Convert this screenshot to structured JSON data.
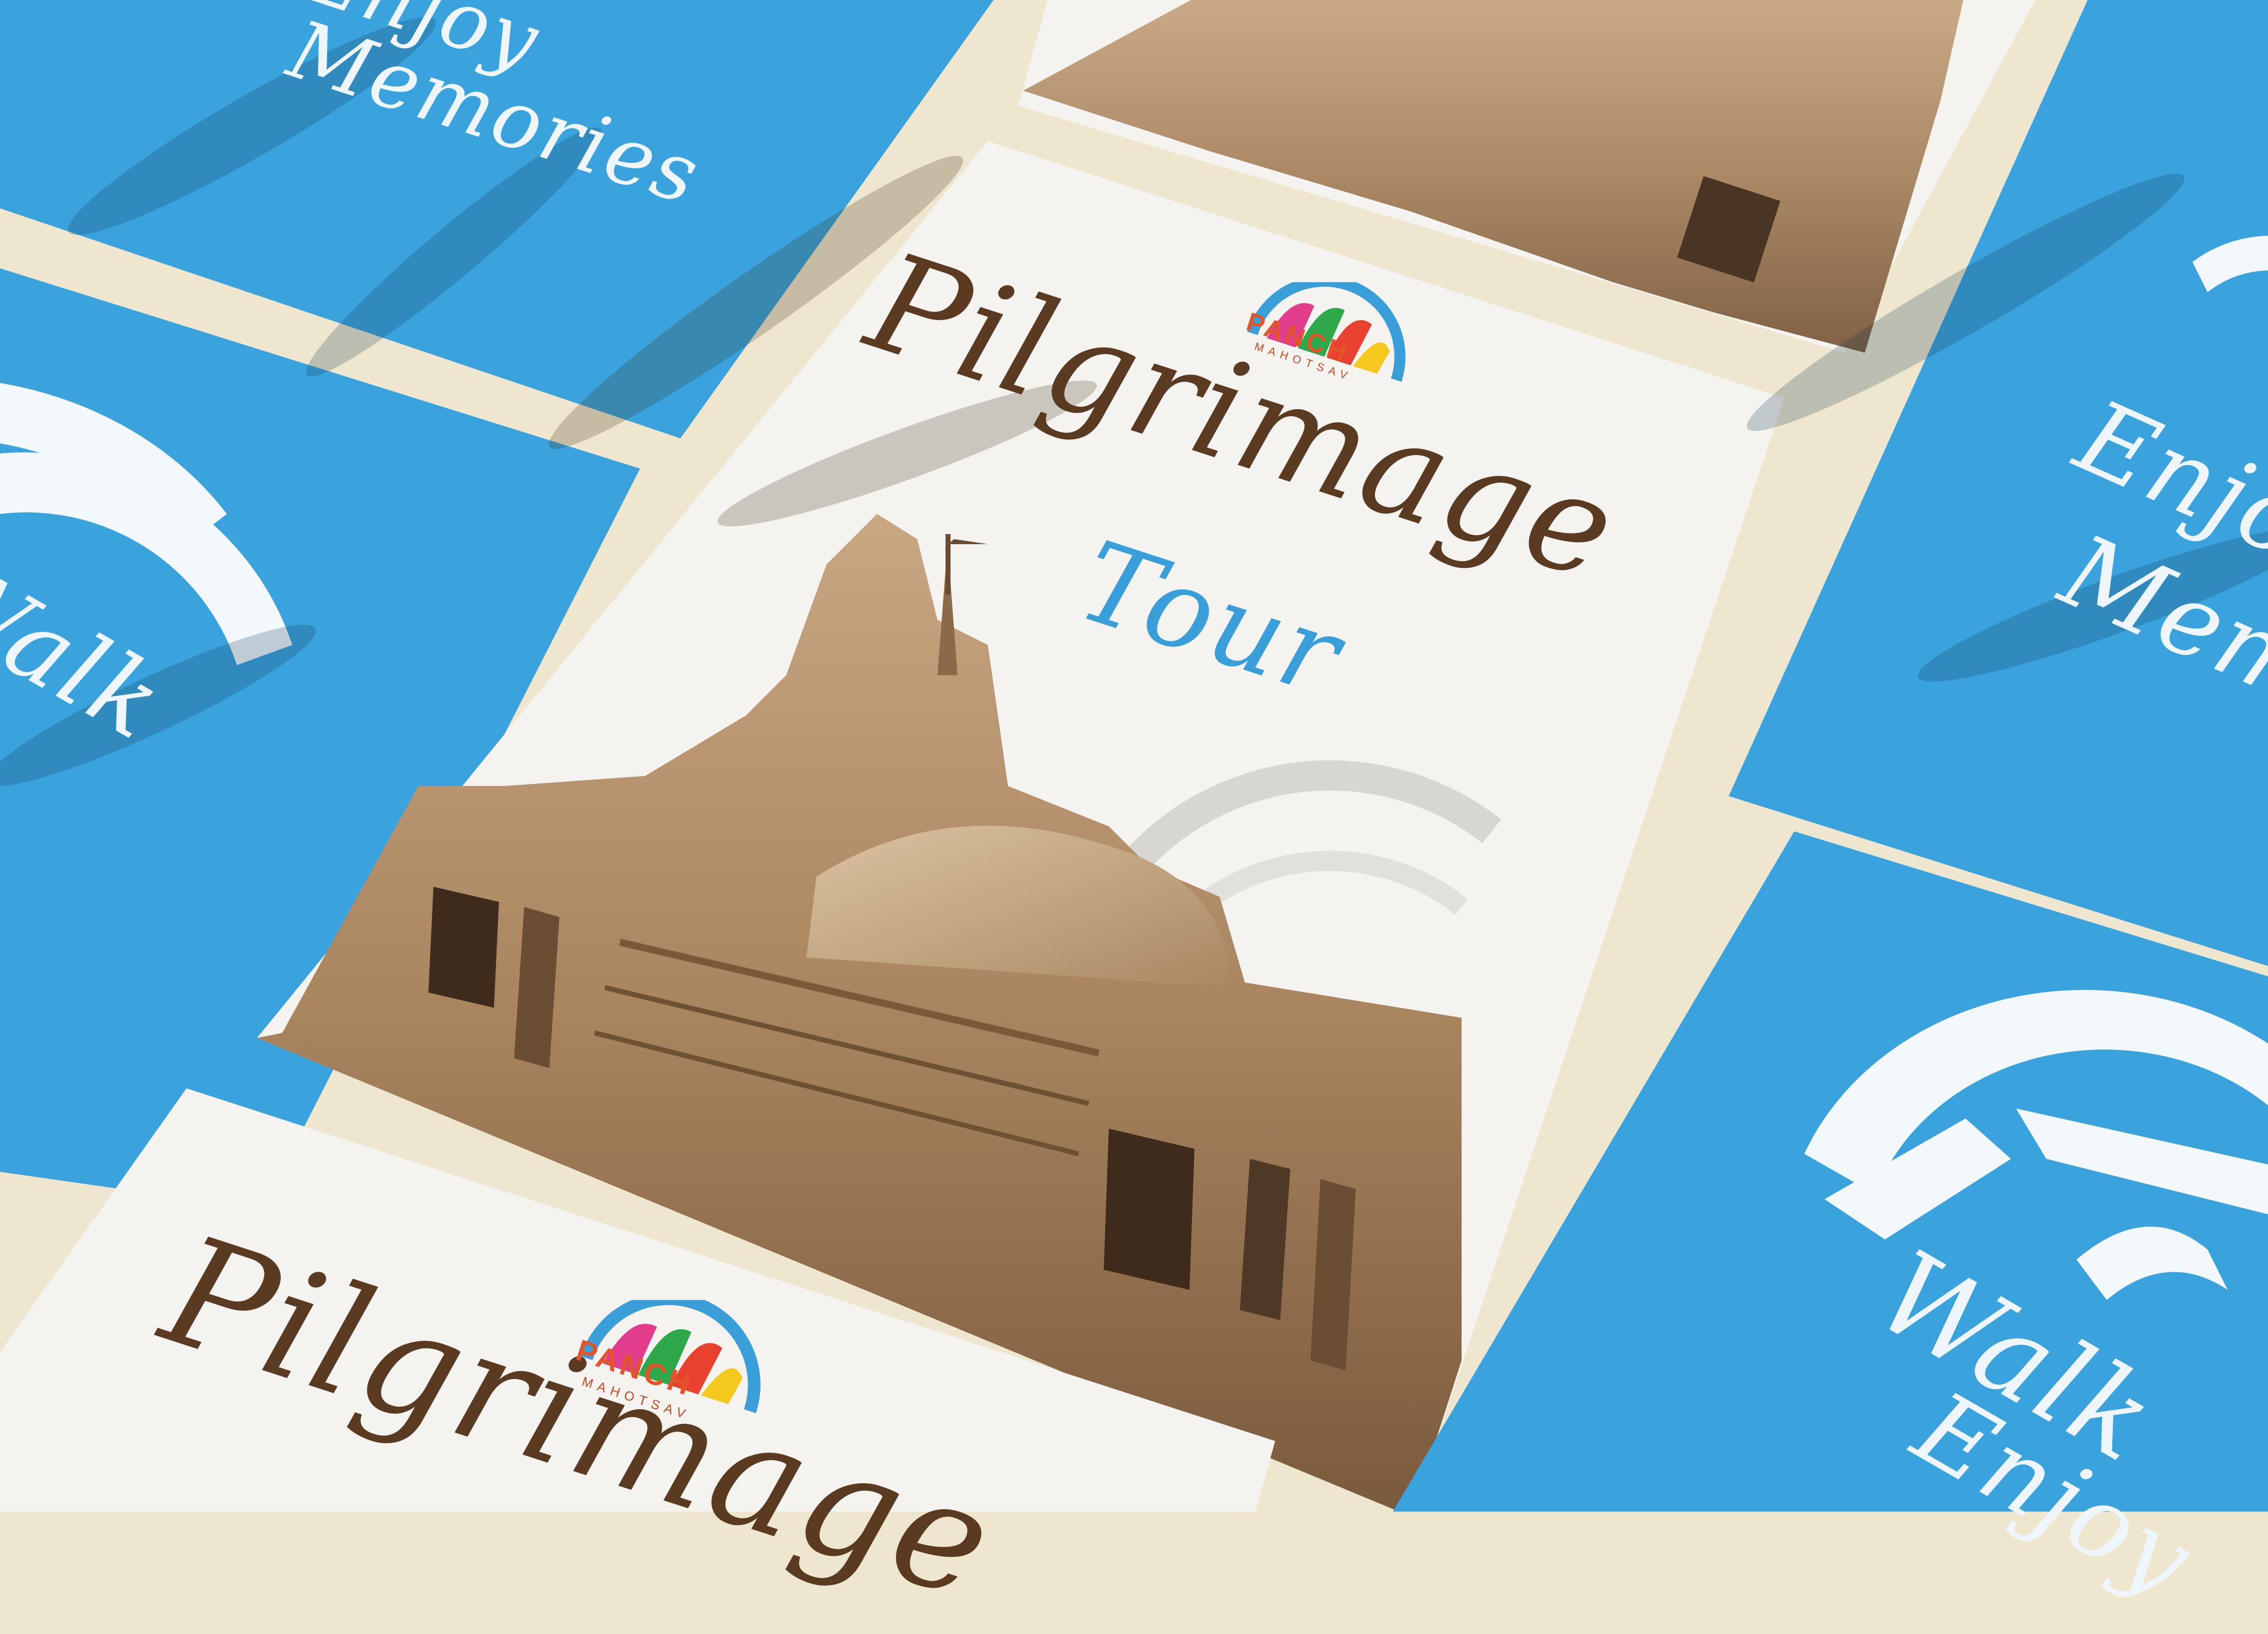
{
  "cards": {
    "top_left": {
      "line1": "Enjoy",
      "line2": "Memories"
    },
    "mid_left": {
      "word": "Walk"
    },
    "main": {
      "title": "Pilgrimage",
      "subtitle": "Tour",
      "logo_word": "PANCH",
      "logo_sub": "MAHOTSAV"
    },
    "bottom": {
      "title": "Pilgrimage",
      "logo_word": "PANCH",
      "logo_sub": "MAHOTSAV"
    },
    "right_top": {
      "line1": "Enjoy",
      "line2": "Memories"
    },
    "right_bottom": {
      "line1": "Walk",
      "line2": "Enjoy"
    }
  },
  "colors": {
    "background": "#efe6cf",
    "card_blue": "#3aa3dd",
    "card_white": "#f4f3f0",
    "title_brown": "#5a3b22",
    "subtitle_blue": "#3a9fd8",
    "logo_orange": "#e2542a"
  }
}
